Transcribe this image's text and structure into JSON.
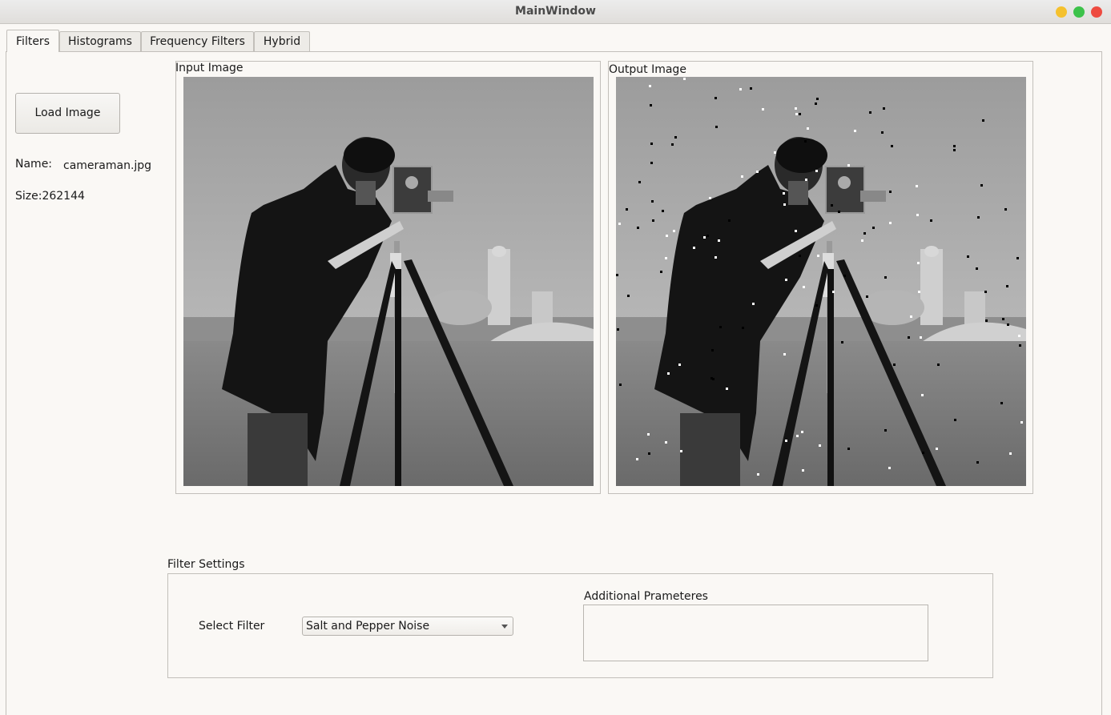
{
  "window": {
    "title": "MainWindow"
  },
  "tabs": [
    {
      "label": "Filters",
      "active": true
    },
    {
      "label": "Histograms",
      "active": false
    },
    {
      "label": "Frequency Filters",
      "active": false
    },
    {
      "label": "Hybrid",
      "active": false
    }
  ],
  "sidebar": {
    "load_button": "Load Image",
    "name_label": "Name:",
    "name_value": "cameraman.jpg",
    "size_text": "Size:262144"
  },
  "input_panel": {
    "title": "Input Image"
  },
  "output_panel": {
    "title": "Output Image"
  },
  "filter_settings": {
    "title": "Filter Settings",
    "select_label": "Select Filter",
    "selected_filter": "Salt and Pepper Noise",
    "additional_params_label": "Additional Prameteres"
  },
  "colors": {
    "window_bg": "#faf8f5",
    "close": "#ee4b40",
    "minimize": "#f5c12e",
    "maximize": "#3cc24a"
  },
  "icons": {
    "close": "close-icon",
    "minimize": "minimize-icon",
    "maximize": "maximize-icon",
    "dropdown": "chevron-down-icon"
  }
}
